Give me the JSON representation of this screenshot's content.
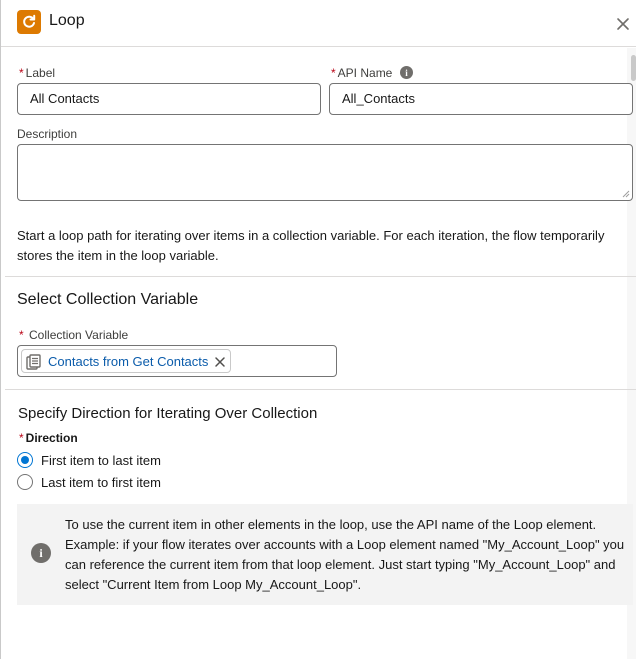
{
  "header": {
    "title": "Loop",
    "icon": "loop-icon",
    "accent": "#dd7a01"
  },
  "fields": {
    "label": {
      "label": "Label",
      "required_mark": "*",
      "value": "All Contacts"
    },
    "api_name": {
      "label": "API Name",
      "required_mark": "*",
      "value": "All_Contacts",
      "info_glyph": "i"
    },
    "description": {
      "label": "Description",
      "value": ""
    }
  },
  "intro_text": "Start a loop path for iterating over items in a collection variable. For each iteration, the flow temporarily stores the item in the loop variable.",
  "collection_section": {
    "title": "Select Collection Variable",
    "field_label": "Collection Variable",
    "required_mark": "*",
    "pill_label": "Contacts from Get Contacts"
  },
  "direction_section": {
    "title": "Specify Direction for Iterating Over Collection",
    "field_label": "Direction",
    "required_mark": "*",
    "options": [
      {
        "label": "First item to last item",
        "selected": true
      },
      {
        "label": "Last item to first item",
        "selected": false
      }
    ]
  },
  "info_box": {
    "glyph": "i",
    "text": "To use the current item in other elements in the loop, use the API name of the Loop element. Example: if your flow iterates over accounts with a Loop element named \"My_Account_Loop\" you can reference the current item from that loop element. Just start typing \"My_Account_Loop\" and select \"Current Item from Loop My_Account_Loop\"."
  },
  "colors": {
    "required": "#ba0517",
    "link": "#0b5cab",
    "brand_blue": "#0176d3",
    "info_bg": "#f3f3f3"
  }
}
